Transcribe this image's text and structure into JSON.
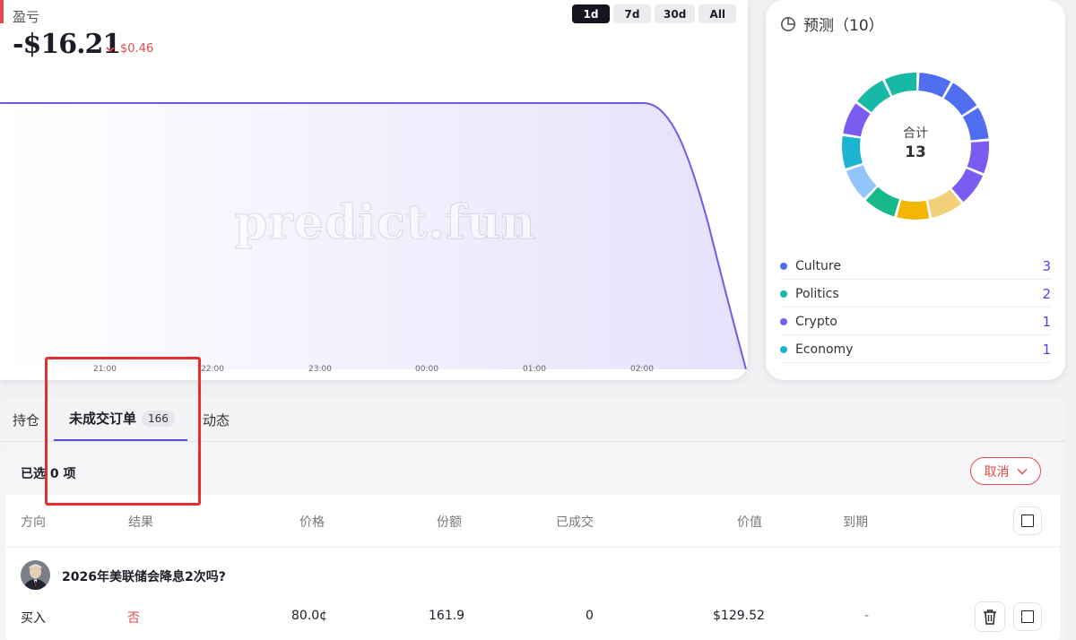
{
  "pnl": {
    "label": "盈亏",
    "value": "-$16.21",
    "change": "$0.46"
  },
  "range_tabs": [
    "1d",
    "7d",
    "30d",
    "All"
  ],
  "range_active": "1d",
  "watermark": "predict.fun",
  "chart_data": {
    "type": "area",
    "x_ticks": [
      "21:00",
      "22:00",
      "23:00",
      "00:00",
      "01:00",
      "02:00"
    ],
    "series_color": "#6d5ce8",
    "note_shape": "flat then sharp decline near end"
  },
  "predictions": {
    "title": "预测（10）",
    "total_label": "合计",
    "total_value": "13",
    "legend": [
      {
        "name": "Culture",
        "count": "3",
        "color": "#4f6ef0"
      },
      {
        "name": "Politics",
        "count": "2",
        "color": "#17b8a6"
      },
      {
        "name": "Crypto",
        "count": "1",
        "color": "#7a5cf0"
      },
      {
        "name": "Economy",
        "count": "1",
        "color": "#1bb4d2"
      }
    ]
  },
  "tabs": {
    "positions": "持仓",
    "orders": "未成交订单",
    "orders_count": "166",
    "activity": "动态"
  },
  "selection": {
    "text": "已选 0 项",
    "cancel": "取消"
  },
  "table": {
    "headers": {
      "direction": "方向",
      "outcome": "结果",
      "price": "价格",
      "shares": "份额",
      "filled": "已成交",
      "value": "价值",
      "expiry": "到期"
    },
    "rows": [
      {
        "market": "2026年美联储会降息2次吗?",
        "direction": "买入",
        "outcome": "否",
        "price": "80.0¢",
        "shares": "161.9",
        "filled": "0",
        "value": "$129.52",
        "expiry": "-"
      }
    ]
  }
}
